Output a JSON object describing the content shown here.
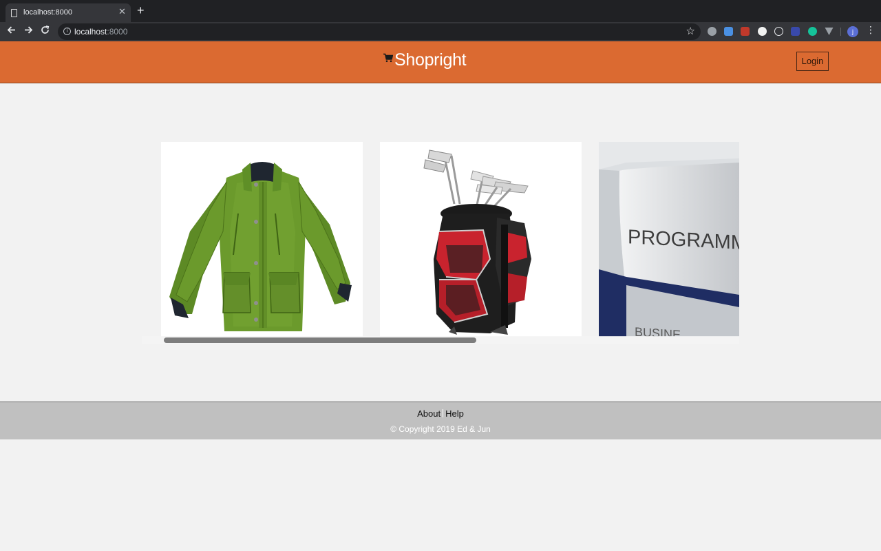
{
  "browser": {
    "tab_title": "localhost:8000",
    "url_host": "localhost",
    "url_port": ":8000",
    "icons": [
      "file-icon",
      "close-icon",
      "plus-icon",
      "back-arrow-icon",
      "forward-arrow-icon",
      "reload-icon",
      "info-icon",
      "star-icon",
      "profile-avatar",
      "menu-dots-icon"
    ],
    "avatar_letter": "j"
  },
  "header": {
    "brand": "Shopright",
    "login_label": "Login",
    "background": "#db6a31"
  },
  "products": [
    {
      "name": "green-jacket-image"
    },
    {
      "name": "golf-bag-image"
    },
    {
      "name": "programming-book-image",
      "label": "PROGRAMMING",
      "sub_label": "BUSINE"
    }
  ],
  "footer": {
    "about": "About",
    "help": "Help",
    "copyright": "© Copyright 2019 Ed & Jun"
  }
}
